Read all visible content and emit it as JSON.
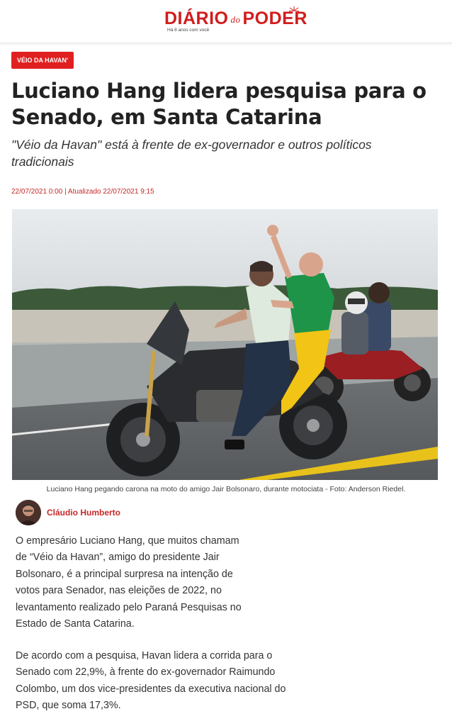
{
  "header": {
    "logo_main_left": "DIÁRIO",
    "logo_do": "do",
    "logo_main_right": "PODER",
    "logo_tagline": "Há 8 anos com você",
    "brand_color": "#d21c1c"
  },
  "article": {
    "tag": "VÉIO DA HAVAN'",
    "headline": "Luciano Hang lidera pesquisa para o Senado, em Santa Catarina",
    "subtitle": "\"Véio da Havan\" está à frente de ex-governador e outros políticos tradicionais",
    "dateline": "22/07/2021 0:00 | Atualizado 22/07/2021 9:15",
    "photo_caption": "Luciano Hang pegando carona na moto do amigo Jair Bolsonaro, durante motociata - Foto: Anderson Riedel.",
    "author": "Cláudio Humberto",
    "paragraphs": [
      "O empresário Luciano Hang, que muitos chamam de “Véio da Havan”, amigo do presidente Jair Bolsonaro, é a principal surpresa na intenção de votos para Senador, nas eleições de 2022, no levantamento realizado pelo Paraná Pesquisas no Estado de Santa Catarina.",
      "De acordo com a pesquisa, Havan lidera a corrida para o Senado com 22,9%, à frente do ex-governador Raimundo Colombo, um dos vice-presidentes da executiva nacional do PSD, que soma 17,3%."
    ]
  },
  "colors": {
    "accent_red": "#e02020",
    "date_red": "#c62828"
  }
}
